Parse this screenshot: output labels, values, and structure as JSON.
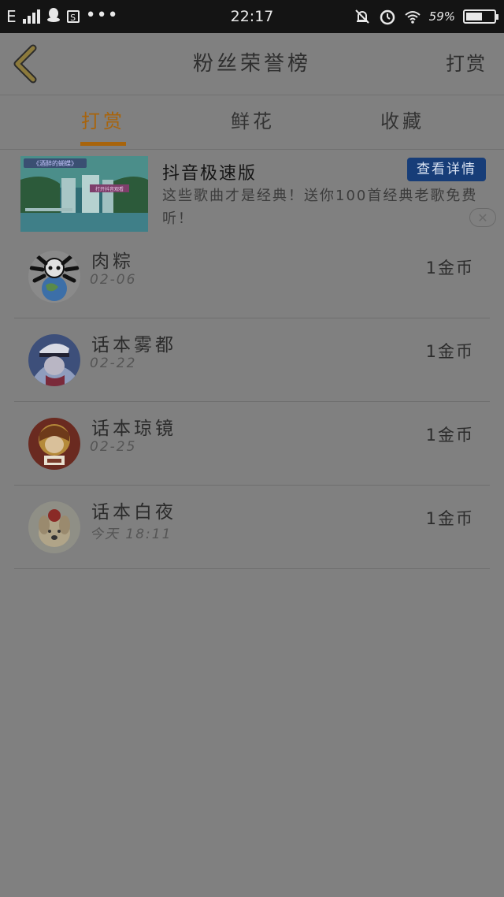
{
  "status_bar": {
    "network": "E",
    "time": "22:17",
    "battery_pct": "59%",
    "battery_level": 0.59,
    "icons": [
      "signal-icon",
      "qq-icon",
      "s-app-icon",
      "more-dots-icon",
      "mute-bell-icon",
      "alarm-icon",
      "wifi-icon",
      "battery-icon"
    ]
  },
  "header": {
    "title": "粉丝荣誉榜",
    "right_action": "打赏",
    "back_icon": "chevron-left-icon"
  },
  "tabs": [
    {
      "label": "打赏",
      "active": true
    },
    {
      "label": "鲜花",
      "active": false
    },
    {
      "label": "收藏",
      "active": false
    }
  ],
  "ad": {
    "title": "抖音极速版",
    "description": "这些歌曲才是经典！送你100首经典老歌免费听！",
    "button": "查看详情",
    "close_icon": "close-icon",
    "thumb_caption": "《酒醉的蝴蝶》",
    "thumb_subcaption": "打开抖音观看"
  },
  "list": [
    {
      "name": "肉粽",
      "date": "02-06",
      "amount": "1金币",
      "avatar_icon": "avatar-skull-earth"
    },
    {
      "name": "话本雾都",
      "date": "02-22",
      "amount": "1金币",
      "avatar_icon": "avatar-kaito"
    },
    {
      "name": "话本琼镜",
      "date": "02-25",
      "amount": "1金币",
      "avatar_icon": "avatar-anime-red"
    },
    {
      "name": "话本白夜",
      "date": "今天  18:11",
      "amount": "1金币",
      "avatar_icon": "avatar-dog"
    }
  ],
  "colors": {
    "overlay_bg": "#808080",
    "accent": "#a8640c",
    "ad_button": "#173d78",
    "status_bar": "#141414"
  }
}
